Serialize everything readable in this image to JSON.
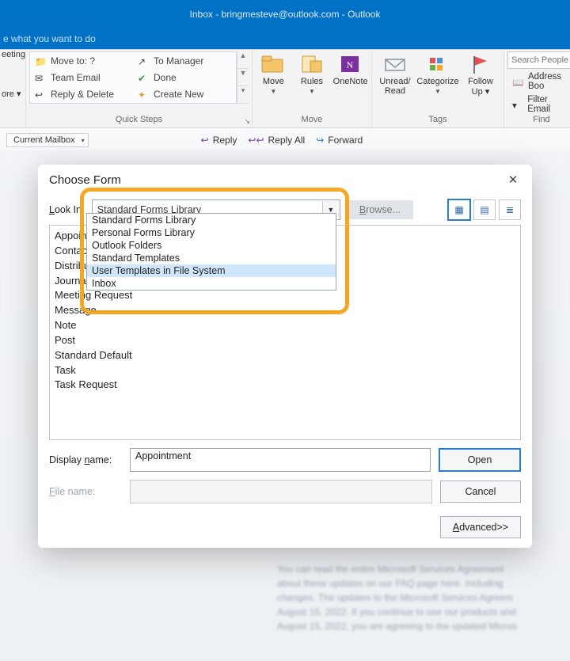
{
  "window": {
    "title": "Inbox - bringmesteve@outlook.com  -  Outlook",
    "tell_me": "e what you want to do"
  },
  "ribbon": {
    "left_trunc": {
      "line1": "eeting",
      "line2": "ore ▾"
    },
    "quick_steps": {
      "label": "Quick Steps",
      "items": [
        "Move to: ?",
        "To Manager",
        "Team Email",
        "Done",
        "Reply & Delete",
        "Create New"
      ]
    },
    "move": {
      "label": "Move",
      "buttons": {
        "move": "Move",
        "rules": "Rules",
        "onenote": "OneNote"
      }
    },
    "tags": {
      "label": "Tags",
      "buttons": {
        "unread": "Unread/\nRead",
        "categorize": "Categorize",
        "followup": "Follow\nUp ▾"
      }
    },
    "find": {
      "label": "Find",
      "search_placeholder": "Search People",
      "address_book": "Address Boo",
      "filter": "Filter Email"
    }
  },
  "toolbar": {
    "scope": "Current Mailbox",
    "reply": "Reply",
    "reply_all": "Reply All",
    "forward": "Forward"
  },
  "dialog": {
    "title": "Choose Form",
    "look_in_label": "Look In:",
    "look_in_value": "Standard Forms Library",
    "browse": "Browse...",
    "options": [
      "Standard Forms Library",
      "Personal Forms Library",
      "Outlook Folders",
      "Standard Templates",
      "User Templates in File System",
      "Inbox"
    ],
    "selected_option_index": 4,
    "forms": [
      "Appointment",
      "Contact",
      "Distribution List",
      "Journal Entry",
      "Meeting Request",
      "Message",
      "Note",
      "Post",
      "Standard Default",
      "Task",
      "Task Request"
    ],
    "display_name_label": "Display name:",
    "display_name_value": "Appointment",
    "file_name_label": "File name:",
    "open": "Open",
    "cancel": "Cancel",
    "advanced": "Advanced>>"
  }
}
